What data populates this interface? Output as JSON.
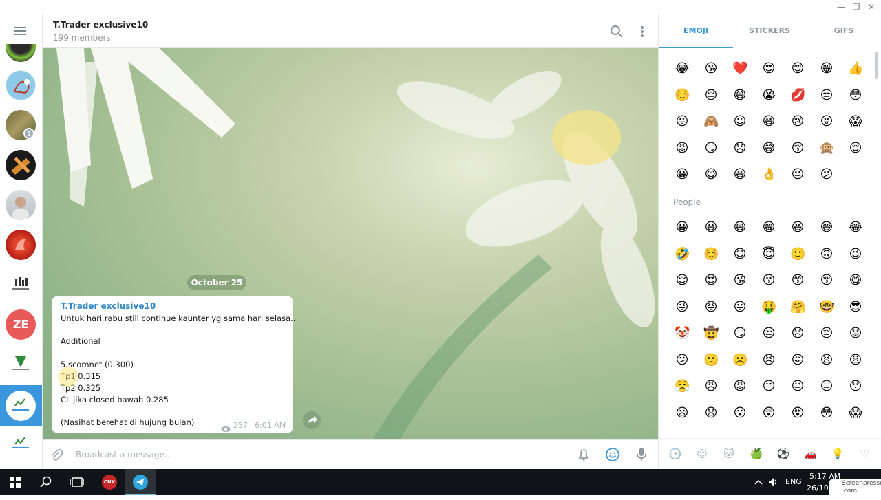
{
  "window": {
    "minimize_glyph": "—",
    "restore_glyph": "❐",
    "close_glyph": "✕"
  },
  "rail": {
    "badge_count": "1",
    "avatar_ze": "ZE"
  },
  "header": {
    "title": "T.Trader exclusive10",
    "subtitle": "199 members"
  },
  "chat": {
    "date": "October 25",
    "message": {
      "author": "T.Trader exclusive10",
      "lines": [
        "Untuk hari rabu still continue kaunter yg sama hari selasa..",
        "",
        "Additional",
        "",
        "5.scomnet (0.300)",
        "Tp1 0.315",
        "Tp2 0.325",
        "CL jika closed bawah 0.285",
        "",
        "(Nasihat berehat di hujung bulan)"
      ],
      "views": "257",
      "time": "6:01 AM"
    }
  },
  "input": {
    "placeholder": "Broadcast a message..."
  },
  "panel": {
    "tabs": [
      "EMOJI",
      "STICKERS",
      "GIFS"
    ],
    "active_tab": "EMOJI",
    "section_label": "People",
    "recent": [
      "😂",
      "😘",
      "❤️",
      "😍",
      "😊",
      "😁",
      "👍",
      "☺️",
      "😔",
      "😄",
      "😭",
      "💋",
      "😒",
      "😳",
      "😜",
      "🙈",
      "😉",
      "😃",
      "😢",
      "😝",
      "😱",
      "😡",
      "😏",
      "😞",
      "😅",
      "😚",
      "🙊",
      "😌",
      "😀",
      "😋",
      "😆",
      "👌",
      "😐",
      "😕"
    ],
    "people": [
      "😀",
      "😃",
      "😄",
      "😁",
      "😆",
      "😅",
      "😂",
      "🤣",
      "☺️",
      "😊",
      "😇",
      "🙂",
      "🙃",
      "😉",
      "😌",
      "😍",
      "😘",
      "😗",
      "😙",
      "😚",
      "😋",
      "😜",
      "😝",
      "😛",
      "🤑",
      "🤗",
      "🤓",
      "😎",
      "🤡",
      "🤠",
      "😏",
      "😒",
      "😞",
      "😔",
      "😟",
      "😕",
      "🙁",
      "☹️",
      "😣",
      "😖",
      "😫",
      "😩",
      "😤",
      "😠",
      "😡",
      "😶",
      "😐",
      "😑",
      "😯",
      "😦",
      "😧",
      "😮",
      "😲",
      "😵",
      "😳",
      "😱"
    ],
    "categories": [
      "🕒",
      "☺",
      "🐱",
      "🍏",
      "⚽",
      "🚗",
      "💡",
      "♡"
    ]
  },
  "taskbar": {
    "time": "5:17 AM",
    "date": "26/10",
    "lang": "ENG",
    "app_label": "CNX"
  },
  "watermark": {
    "text": "Screenpresso .com"
  },
  "colors": {
    "accent": "#3a96dd",
    "author": "#2f86c8"
  }
}
